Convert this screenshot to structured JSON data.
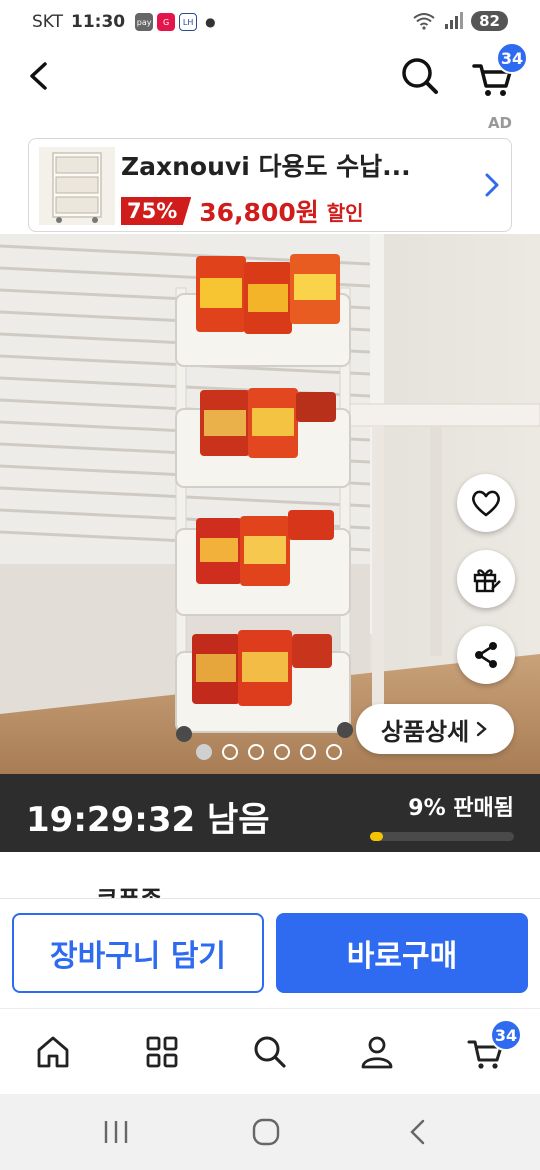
{
  "status_bar": {
    "carrier": "SKT",
    "time": "11:30",
    "battery": "82",
    "notification_icons": [
      "pay-icon",
      "gmarket-icon",
      "lh-icon"
    ]
  },
  "header": {
    "cart_count": "34"
  },
  "ad": {
    "label": "AD",
    "title": "Zaxnouvi 다용도 수납...",
    "discount": "75%",
    "price": "36,800원",
    "sale_text": "할인"
  },
  "product": {
    "detail_button": "상품상세",
    "image_count": 6,
    "active_image_index": 0
  },
  "deal": {
    "time_left": "19:29:32 남음",
    "sold_text": "9% 판매됨",
    "sold_percent": 9
  },
  "peek_text": "쿠폰존",
  "actions": {
    "add_to_cart": "장바구니 담기",
    "buy_now": "바로구매"
  },
  "bottom_nav": {
    "items": [
      "home-icon",
      "category-icon",
      "search-icon",
      "my-page-icon",
      "cart-icon"
    ],
    "cart_count": "34"
  },
  "colors": {
    "accent": "#2f6bf1",
    "sale_red": "#d11c1c",
    "timer_bg": "#2d2d2d",
    "progress": "#f5c400"
  }
}
